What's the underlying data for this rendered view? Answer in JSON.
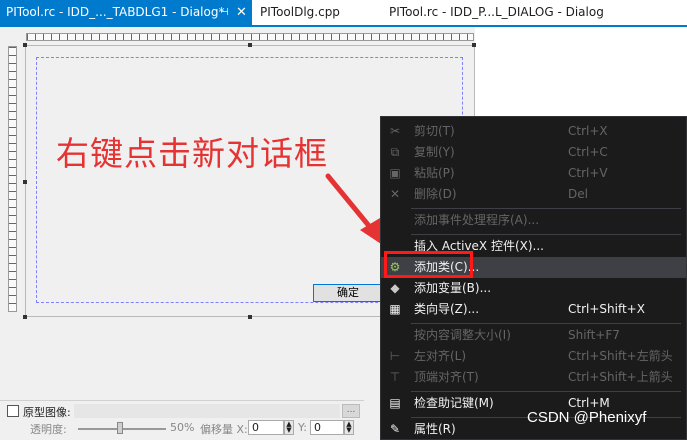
{
  "tabs": [
    {
      "label": "PITool.rc - IDD_..._TABDLG1 - Dialog*",
      "active": true
    },
    {
      "label": "PIToolDlg.cpp",
      "active": false
    },
    {
      "label": "PITool.rc - IDD_P...L_DIALOG - Dialog",
      "active": false
    }
  ],
  "tab_icons": {
    "pin": "pin-icon",
    "close": "close-icon"
  },
  "dialog": {
    "ok_button": "确定",
    "annotation": "右键点击新对话框",
    "annotation_color": "#e53333"
  },
  "image_bar": {
    "checkbox_label": "原型图像:",
    "browse": "...",
    "opacity_label": "透明度:",
    "opacity_value": "50%",
    "offset_label": "偏移量 X:",
    "x_value": "0",
    "y_label": "Y:",
    "y_value": "0"
  },
  "context_menu": {
    "items": [
      {
        "icon": "cut-icon",
        "glyph": "✂",
        "label": "剪切(T)",
        "shortcut": "Ctrl+X",
        "disabled": true
      },
      {
        "icon": "copy-icon",
        "glyph": "⧉",
        "label": "复制(Y)",
        "shortcut": "Ctrl+C",
        "disabled": true
      },
      {
        "icon": "paste-icon",
        "glyph": "📋",
        "label": "粘贴(P)",
        "shortcut": "Ctrl+V",
        "disabled": true
      },
      {
        "icon": "delete-icon",
        "glyph": "✕",
        "label": "删除(D)",
        "shortcut": "Del",
        "disabled": true
      },
      {
        "icon": "",
        "glyph": "",
        "label": "添加事件处理程序(A)...",
        "shortcut": "",
        "disabled": true
      },
      {
        "icon": "",
        "glyph": "",
        "label": "插入 ActiveX 控件(X)...",
        "shortcut": "",
        "disabled": false
      },
      {
        "icon": "add-class-icon",
        "glyph": "⚙",
        "label": "添加类(C)...",
        "shortcut": "",
        "disabled": false,
        "highlighted": true
      },
      {
        "icon": "add-variable-icon",
        "glyph": "◆",
        "label": "添加变量(B)...",
        "shortcut": "",
        "disabled": false
      },
      {
        "icon": "class-wizard-icon",
        "glyph": "▦",
        "label": "类向导(Z)...",
        "shortcut": "Ctrl+Shift+X",
        "disabled": false
      },
      {
        "icon": "",
        "glyph": "",
        "label": "按内容调整大小(I)",
        "shortcut": "Shift+F7",
        "disabled": true
      },
      {
        "icon": "align-left-icon",
        "glyph": "⊢",
        "label": "左对齐(L)",
        "shortcut": "Ctrl+Shift+左箭头",
        "disabled": true
      },
      {
        "icon": "align-top-icon",
        "glyph": "⊤",
        "label": "顶端对齐(T)",
        "shortcut": "Ctrl+Shift+上箭头",
        "disabled": true
      },
      {
        "icon": "check-mnemonics-icon",
        "glyph": "▤",
        "label": "检查助记键(M)",
        "shortcut": "Ctrl+M",
        "disabled": false
      },
      {
        "icon": "properties-icon",
        "glyph": "🔧",
        "label": "属性(R)",
        "shortcut": "",
        "disabled": false
      }
    ]
  },
  "watermark": "CSDN @Phenixyf"
}
